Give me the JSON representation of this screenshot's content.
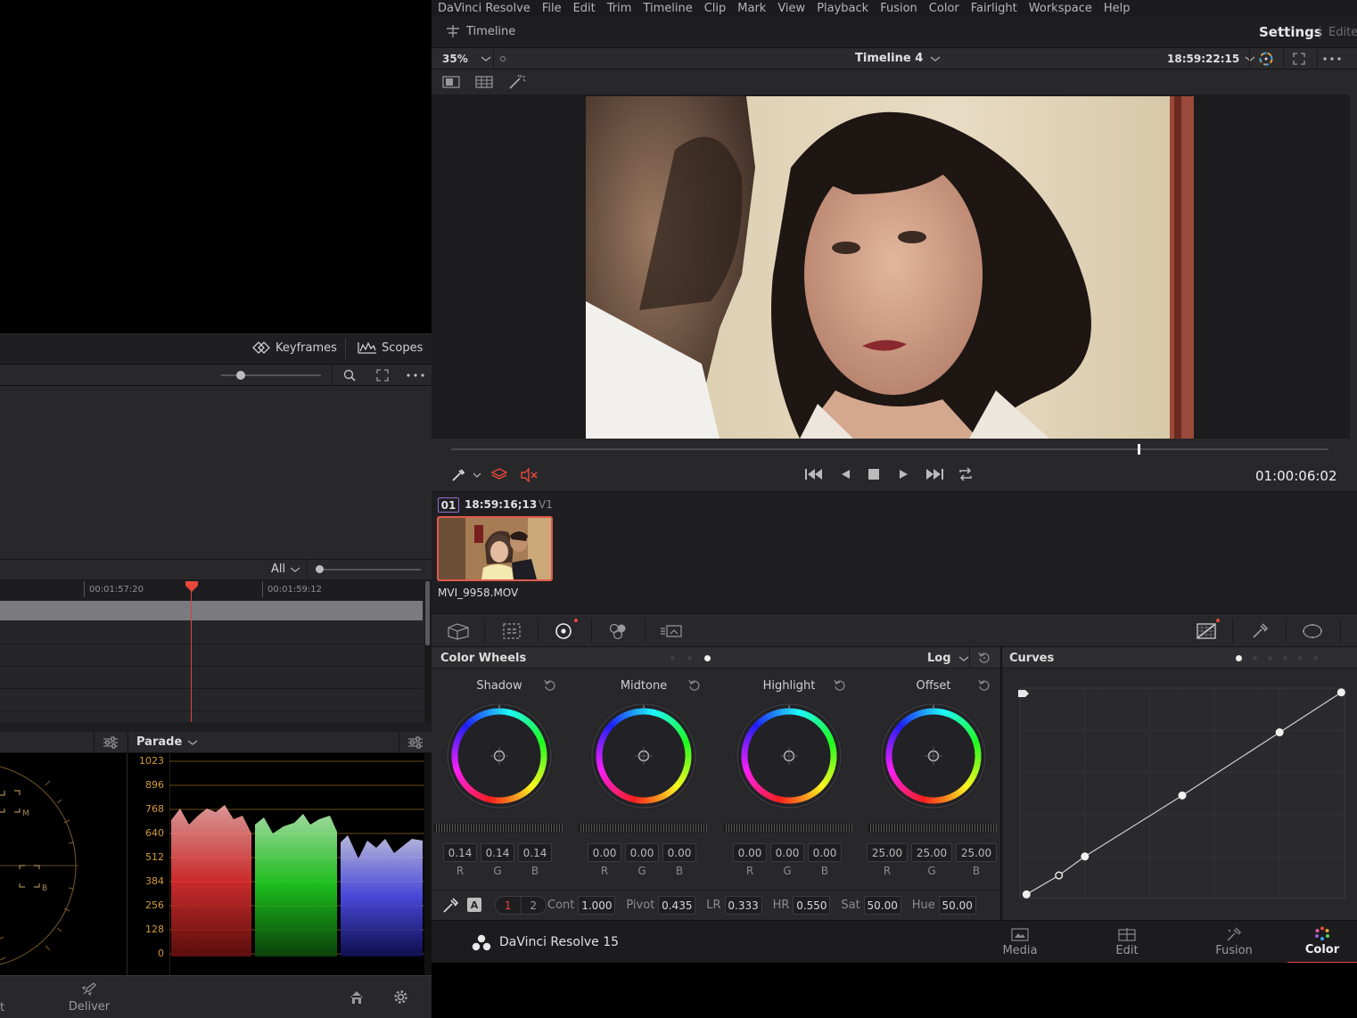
{
  "app": {
    "name": "DaVinci Resolve 15"
  },
  "menu": [
    "DaVinci Resolve",
    "File",
    "Edit",
    "Trim",
    "Timeline",
    "Clip",
    "Mark",
    "View",
    "Playback",
    "Fusion",
    "Color",
    "Fairlight",
    "Workspace",
    "Help"
  ],
  "titlebar": {
    "timeline_label": "Timeline",
    "settings_label": "Settings",
    "edit_label": "Edite"
  },
  "viewer": {
    "zoom": "35%",
    "timeline_name": "Timeline 4",
    "source_timecode": "18:59:22:15",
    "current_timecode": "01:00:06:02",
    "playhead_fraction": 0.783
  },
  "clip": {
    "number": "01",
    "timecode": "18:59:16;13",
    "track": "V1",
    "filename": "MVI_9958.MOV"
  },
  "left": {
    "keyframes_label": "Keyframes",
    "scopes_label": "Scopes",
    "filter_label": "All",
    "ruler_ticks": [
      "00:01:57:20",
      "00:01:59:12"
    ],
    "scope_mode": "Parade",
    "scope_scale": [
      "1023",
      "896",
      "768",
      "640",
      "512",
      "384",
      "256",
      "128",
      "0"
    ],
    "vectorscope_marks": [
      "M",
      "B"
    ],
    "deliver_label": "Deliver",
    "partial_label": "t"
  },
  "color_wheels": {
    "title": "Color Wheels",
    "mode": "Log",
    "wheels": [
      {
        "name": "Shadow",
        "values": [
          "0.14",
          "0.14",
          "0.14"
        ]
      },
      {
        "name": "Midtone",
        "values": [
          "0.00",
          "0.00",
          "0.00"
        ]
      },
      {
        "name": "Highlight",
        "values": [
          "0.00",
          "0.00",
          "0.00"
        ]
      },
      {
        "name": "Offset",
        "values": [
          "25.00",
          "25.00",
          "25.00"
        ]
      }
    ],
    "channel_labels": [
      "R",
      "G",
      "B"
    ],
    "page_buttons": [
      "1",
      "2"
    ],
    "auto_label": "A",
    "params": [
      {
        "label": "Cont",
        "value": "1.000"
      },
      {
        "label": "Pivot",
        "value": "0.435"
      },
      {
        "label": "LR",
        "value": "0.333"
      },
      {
        "label": "HR",
        "value": "0.550"
      },
      {
        "label": "Sat",
        "value": "50.00"
      },
      {
        "label": "Hue",
        "value": "50.00"
      }
    ]
  },
  "curves": {
    "title": "Curves",
    "points": [
      [
        0.02,
        0.02
      ],
      [
        0.12,
        0.11
      ],
      [
        0.2,
        0.2
      ],
      [
        0.5,
        0.49
      ],
      [
        0.8,
        0.79
      ],
      [
        0.99,
        0.98
      ]
    ]
  },
  "pages": [
    "Media",
    "Edit",
    "Fusion",
    "Color"
  ],
  "active_page": "Color",
  "colors": {
    "accent": "#e8473b",
    "clip_border": "#e25a4e",
    "background": "#28282b"
  }
}
